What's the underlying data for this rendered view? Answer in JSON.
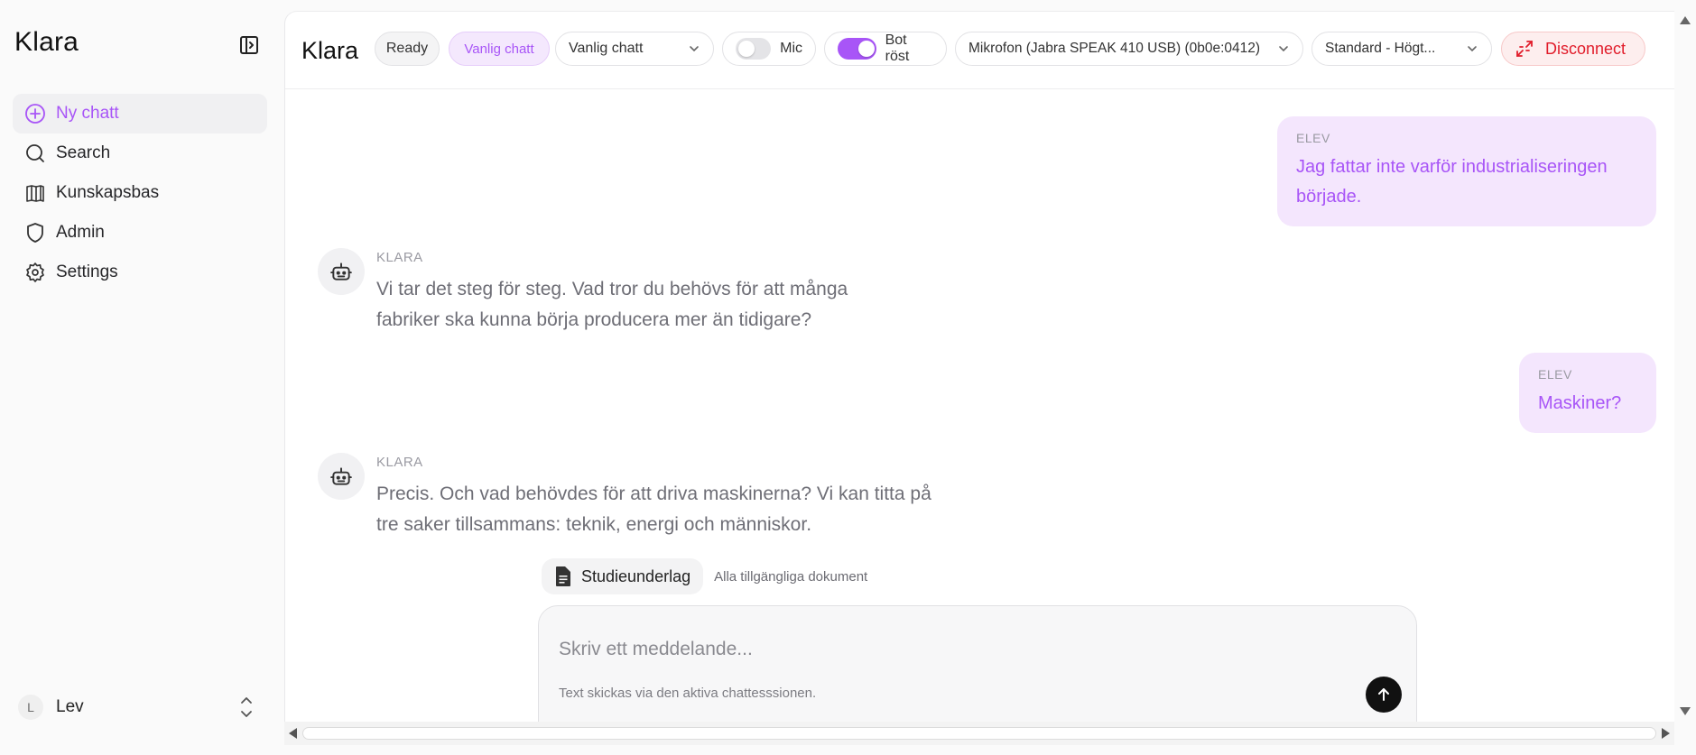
{
  "sidebar": {
    "brand": "Klara",
    "items": [
      {
        "label": "Ny chatt",
        "icon": "plus-circle-icon"
      },
      {
        "label": "Search",
        "icon": "search-icon"
      },
      {
        "label": "Kunskapsbas",
        "icon": "library-icon"
      },
      {
        "label": "Admin",
        "icon": "shield-icon"
      },
      {
        "label": "Settings",
        "icon": "gear-icon"
      }
    ],
    "user": {
      "initial": "L",
      "name": "Lev"
    }
  },
  "topbar": {
    "title": "Klara",
    "status": "Ready",
    "mode_badge": "Vanlig chatt",
    "mode_select": "Vanlig chatt",
    "mic_label": "Mic",
    "mic_on": false,
    "bot_voice_label": "Bot röst",
    "bot_voice_on": true,
    "microphone_select": "Mikrofon (Jabra SPEAK 410 USB) (0b0e:0412)",
    "speaker_select": "Standard - Högt...",
    "disconnect_label": "Disconnect"
  },
  "messages": [
    {
      "role": "ELEV",
      "text": "Jag fattar inte varför industrialiseringen började."
    },
    {
      "role": "KLARA",
      "text": "Vi tar det steg för steg. Vad tror du behövs för att många fabriker ska kunna börja producera mer än tidigare?"
    },
    {
      "role": "ELEV",
      "text": "Maskiner?"
    },
    {
      "role": "KLARA",
      "text": "Precis. Och vad behövdes för att driva maskinerna? Vi kan titta på tre saker tillsammans: teknik, energi och människor."
    }
  ],
  "composer": {
    "context_label": "Studieunderlag",
    "context_note": "Alla tillgängliga dokument",
    "placeholder": "Skriv ett meddelande...",
    "hint": "Text skickas via den aktiva chattesssionen."
  },
  "colors": {
    "accent": "#a855f7",
    "user_bubble": "#f4e6fd",
    "danger": "#e11d2b"
  }
}
